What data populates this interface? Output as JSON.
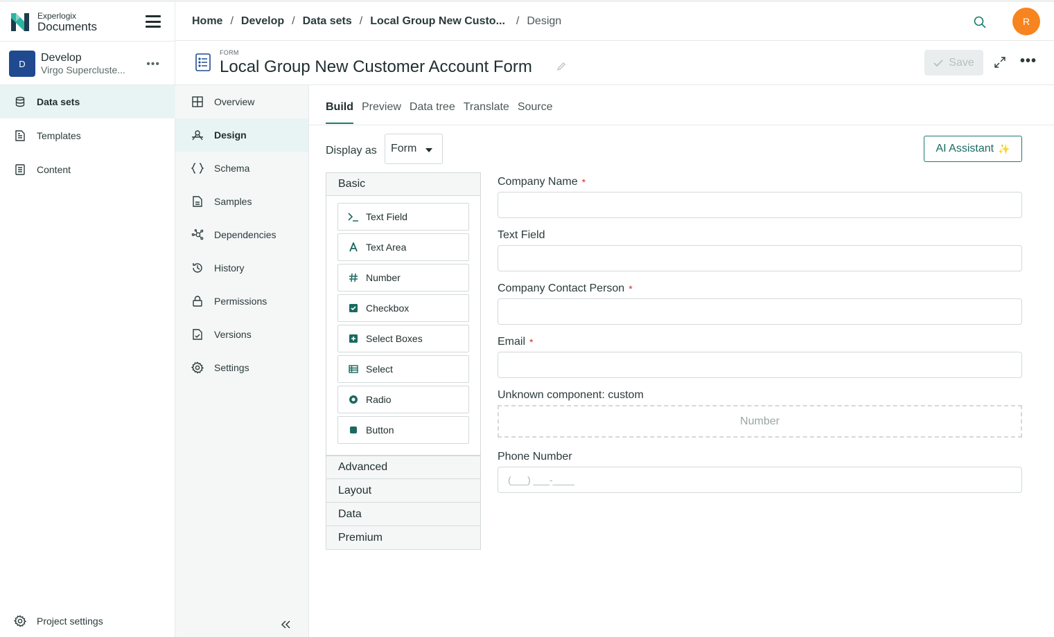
{
  "brand": {
    "small": "Experlogix",
    "big": "Documents"
  },
  "project": {
    "avatar": "D",
    "name": "Develop",
    "sub": "Virgo Supercluste...",
    "more": "•••"
  },
  "sidebar": {
    "items": [
      {
        "label": "Data sets"
      },
      {
        "label": "Templates"
      },
      {
        "label": "Content"
      }
    ],
    "project_settings": "Project settings"
  },
  "breadcrumb": {
    "items": [
      "Home",
      "Develop",
      "Data sets",
      "Local Group New Custo..."
    ],
    "current": "Design",
    "separator": "/"
  },
  "user": {
    "initial": "R"
  },
  "titlebar": {
    "kicker": "FORM",
    "title": "Local Group New Customer Account Form",
    "save_label": "Save",
    "more": "•••"
  },
  "subnav": {
    "items": [
      {
        "label": "Overview"
      },
      {
        "label": "Design"
      },
      {
        "label": "Schema"
      },
      {
        "label": "Samples"
      },
      {
        "label": "Dependencies"
      },
      {
        "label": "History"
      },
      {
        "label": "Permissions"
      },
      {
        "label": "Versions"
      },
      {
        "label": "Settings"
      }
    ]
  },
  "tabs": [
    "Build",
    "Preview",
    "Data tree",
    "Translate",
    "Source"
  ],
  "display": {
    "label": "Display as",
    "value": "Form"
  },
  "ai_button": {
    "label": "AI Assistant",
    "sparkle": "✨"
  },
  "palette": {
    "basic": "Basic",
    "items": [
      "Text Field",
      "Text Area",
      "Number",
      "Checkbox",
      "Select Boxes",
      "Select",
      "Radio",
      "Button"
    ],
    "groups": [
      "Advanced",
      "Layout",
      "Data",
      "Premium"
    ]
  },
  "form": {
    "company_name": "Company Name",
    "text_field": "Text Field",
    "contact_person": "Company Contact Person",
    "email": "Email",
    "required_mark": "*",
    "custom_label": "Unknown component: custom",
    "custom_content": "Number",
    "phone_label": "Phone Number",
    "phone_placeholder": "(___) ___-____"
  },
  "colors": {
    "accent": "#1a7a6e",
    "avatar": "#f7841f",
    "project": "#1f4a8f",
    "required": "#d0312d"
  }
}
